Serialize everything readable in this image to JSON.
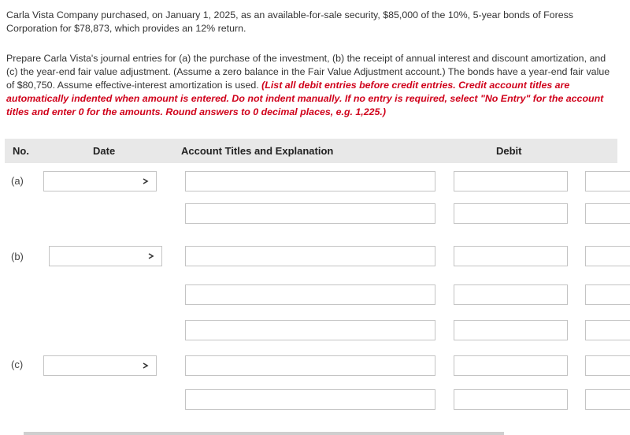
{
  "problem": {
    "intro": "Carla Vista Company purchased, on January 1, 2025, as an available-for-sale security, $85,000 of the 10%, 5-year bonds of Foress Corporation for $78,873, which provides an 12% return.",
    "task": "Prepare Carla Vista's journal entries for (a) the purchase of the investment, (b) the receipt of annual interest and discount amortization, and (c) the year-end fair value adjustment. (Assume a zero balance in the Fair Value Adjustment account.) The bonds have a year-end fair value of $80,750. Assume effective-interest amortization is used. ",
    "instructions": "(List all debit entries before credit entries. Credit account titles are automatically indented when amount is entered. Do not indent manually. If no entry is required, select \"No Entry\" for the account titles and enter 0 for the amounts. Round answers to 0 decimal places, e.g. 1,225.)"
  },
  "table": {
    "headers": {
      "no": "No.",
      "date": "Date",
      "account": "Account Titles and Explanation",
      "debit": "Debit"
    },
    "entries": [
      {
        "label": "(a)",
        "date": "",
        "lines": [
          {
            "account": "",
            "debit": "",
            "credit": ""
          },
          {
            "account": "",
            "debit": "",
            "credit": ""
          }
        ]
      },
      {
        "label": "(b)",
        "date": "",
        "lines": [
          {
            "account": "",
            "debit": "",
            "credit": ""
          },
          {
            "account": "",
            "debit": "",
            "credit": ""
          },
          {
            "account": "",
            "debit": "",
            "credit": ""
          }
        ]
      },
      {
        "label": "(c)",
        "date": "",
        "lines": [
          {
            "account": "",
            "debit": "",
            "credit": ""
          },
          {
            "account": "",
            "debit": "",
            "credit": ""
          }
        ]
      }
    ]
  },
  "icons": {
    "dropdown": "chevron-down-icon"
  },
  "colors": {
    "instructions": "#d0021b",
    "header_bg": "#e8e8e8",
    "field_border": "#c4c4c4"
  }
}
